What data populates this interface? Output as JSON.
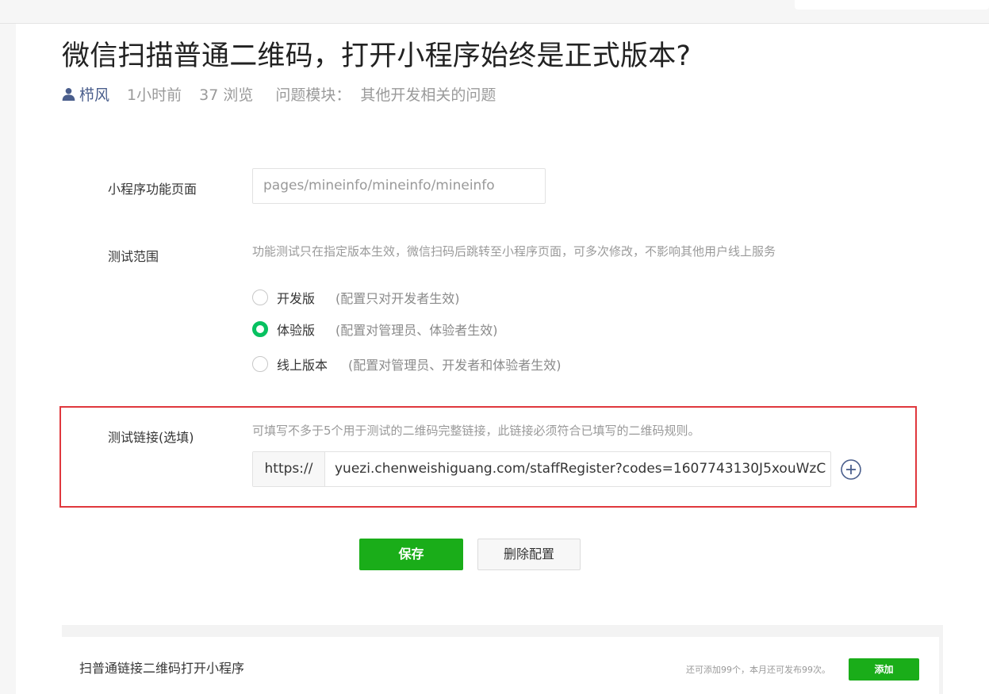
{
  "question": {
    "title": "微信扫描普通二维码，打开小程序始终是正式版本?",
    "author": "栉风",
    "time": "1小时前",
    "views": "37 浏览",
    "module_label": "问题模块：",
    "module_value": "其他开发相关的问题"
  },
  "form": {
    "page_label": "小程序功能页面",
    "page_placeholder": "pages/mineinfo/mineinfo/mineinfo",
    "scope_label": "测试范围",
    "scope_description": "功能测试只在指定版本生效，微信扫码后跳转至小程序页面，可多次修改，不影响其他用户线上服务",
    "scope_options": [
      {
        "label": "开发版",
        "note": "(配置只对开发者生效)",
        "checked": false
      },
      {
        "label": "体验版",
        "note": "(配置对管理员、体验者生效)",
        "checked": true
      },
      {
        "label": "线上版本",
        "note": "(配置对管理员、开发者和体验者生效)",
        "checked": false
      }
    ],
    "test_link_label": "测试链接(选填)",
    "test_link_hint": "可填写不多于5个用于测试的二维码完整链接，此链接必须符合已填写的二维码规则。",
    "url_prefix": "https://",
    "url_value": "yuezi.chenweishiguang.com/staffRegister?codes=1607743130J5xouWzC",
    "save_label": "保存",
    "delete_label": "删除配置"
  },
  "panel": {
    "title": "扫普通链接二维码打开小程序",
    "quota": "还可添加99个，本月还可发布99次。",
    "add_label": "添加"
  },
  "colors": {
    "accent_green": "#1aad19",
    "radio_green": "#07c160",
    "highlight_red": "#e0383d",
    "author_blue": "#4a5e8c"
  }
}
